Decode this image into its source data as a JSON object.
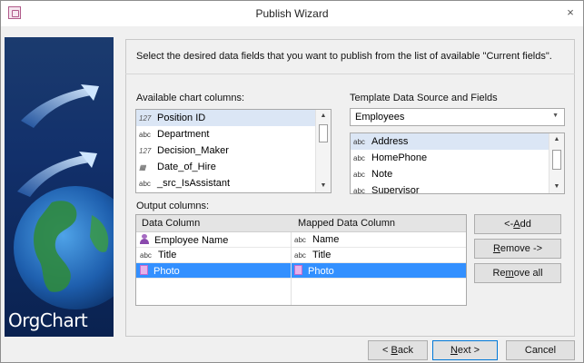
{
  "window": {
    "title": "Publish Wizard",
    "close_glyph": "×"
  },
  "banner": {
    "text": "OrgChart"
  },
  "instruction": "Select the desired data fields that you want to publish from the list of available \"Current fields\".",
  "available": {
    "label": "Available chart  columns:",
    "items": [
      {
        "type": "127",
        "label": "Position ID"
      },
      {
        "type": "abc",
        "label": "Department"
      },
      {
        "type": "127",
        "label": "Decision_Maker"
      },
      {
        "type": "date",
        "label": "Date_of_Hire"
      },
      {
        "type": "abc",
        "label": "_src_IsAssistant"
      }
    ]
  },
  "template": {
    "label": "Template Data Source and Fields",
    "source_value": "Employees",
    "fields": [
      {
        "type": "abc",
        "label": "Address"
      },
      {
        "type": "abc",
        "label": "HomePhone"
      },
      {
        "type": "abc",
        "label": "Note"
      },
      {
        "type": "abc",
        "label": "Supervisor"
      }
    ]
  },
  "output": {
    "label": "Output columns:",
    "headers": {
      "data_column": "Data Column",
      "mapped_column": "Mapped Data Column"
    },
    "rows": [
      {
        "icon": "person-icon",
        "data": "Employee Name",
        "mapped_type": "abc",
        "mapped": "Name"
      },
      {
        "icon": "abc",
        "data": "Title",
        "mapped_type": "abc",
        "mapped": "Title"
      },
      {
        "icon": "image-icon",
        "data": "Photo",
        "mapped_type": "image-icon",
        "mapped": "Photo"
      }
    ]
  },
  "actions": {
    "add": {
      "prefix": "<-",
      "key": "A",
      "rest": "dd"
    },
    "remove": {
      "key": "R",
      "rest": "emove ->"
    },
    "remove_all": {
      "prefix": "Re",
      "key": "m",
      "rest": "ove all"
    }
  },
  "footer": {
    "back": {
      "prefix": "< ",
      "key": "B",
      "rest": "ack"
    },
    "next": {
      "key": "N",
      "rest": "ext >"
    },
    "cancel": "Cancel"
  },
  "colors": {
    "selection": "#3390ff",
    "banner": "#12306b",
    "accent": "#0078d7"
  }
}
